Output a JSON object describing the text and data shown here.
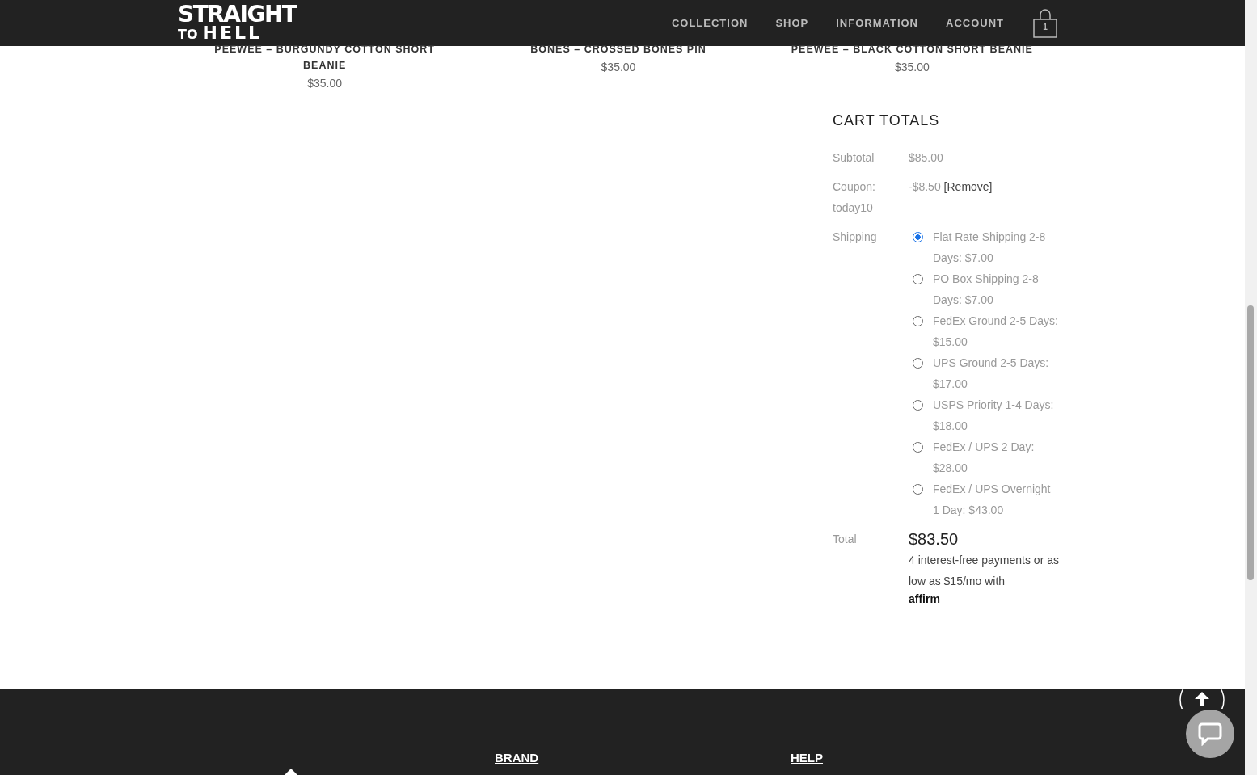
{
  "header": {
    "logo": {
      "line1": "STRAIGHT",
      "line2a": "TO",
      "line2b": "HELL"
    },
    "nav": [
      {
        "label": "COLLECTION"
      },
      {
        "label": "SHOP"
      },
      {
        "label": "INFORMATION"
      },
      {
        "label": "ACCOUNT"
      }
    ],
    "cart_count": "1"
  },
  "products": [
    {
      "title": "PEEWEE – BURGUNDY COTTON SHORT BEANIE",
      "price": "$35.00"
    },
    {
      "title": "BONES – CROSSED BONES PIN",
      "price": "$35.00"
    },
    {
      "title": "PEEWEE – BLACK COTTON SHORT BEANIE",
      "price": "$35.00"
    }
  ],
  "cart_totals": {
    "title": "CART TOTALS",
    "subtotal": {
      "label": "Subtotal",
      "value": "$85.00"
    },
    "coupon": {
      "label": "Coupon: today10",
      "value": "-$8.50",
      "remove": "[Remove]"
    },
    "shipping": {
      "label": "Shipping",
      "options": [
        {
          "label": "Flat Rate Shipping 2-8 Days: $7.00",
          "selected": true
        },
        {
          "label": "PO Box Shipping 2-8 Days: $7.00",
          "selected": false
        },
        {
          "label": "FedEx Ground 2-5 Days: $15.00",
          "selected": false
        },
        {
          "label": "UPS Ground 2-5 Days: $17.00",
          "selected": false
        },
        {
          "label": "USPS Priority 1-4 Days: $18.00",
          "selected": false
        },
        {
          "label": "FedEx / UPS 2 Day: $28.00",
          "selected": false
        },
        {
          "label": "FedEx / UPS Overnight 1 Day: $43.00",
          "selected": false
        }
      ]
    },
    "total": {
      "label": "Total",
      "value": "$83.50"
    },
    "financing": {
      "text": "4 interest-free payments or as low as $15/mo with",
      "brand": "affirm"
    }
  },
  "footer": {
    "columns": [
      {
        "heading": "BRAND"
      },
      {
        "heading": "HELP"
      }
    ]
  }
}
